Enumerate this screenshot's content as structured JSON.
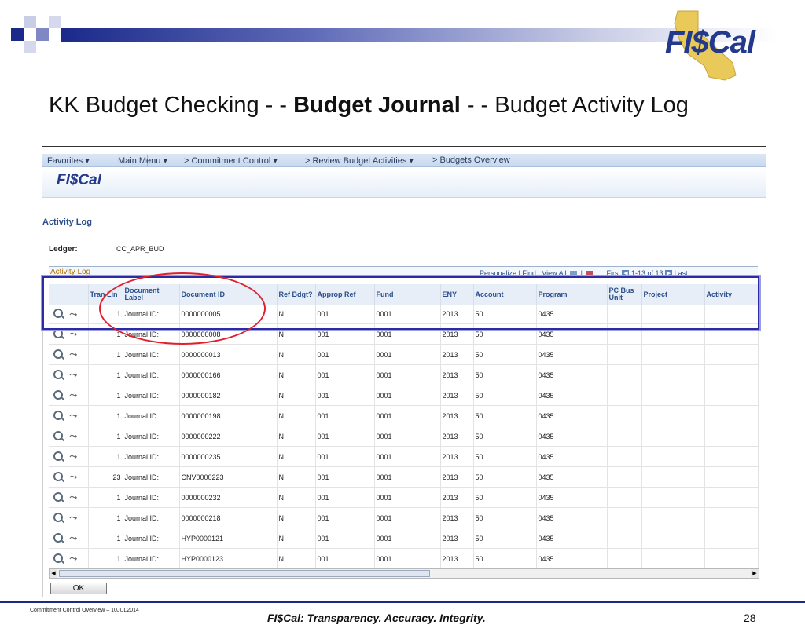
{
  "slide": {
    "logo_text": "FI$Cal",
    "title_prefix": "KK Budget Checking - - ",
    "title_bold": "Budget Journal",
    "title_suffix": " - - Budget Activity Log",
    "footer_left": "Commitment Control Overview – 10JUL2014",
    "footer_center": "FI$Cal:  Transparency.  Accuracy.  Integrity.",
    "page_number": "28"
  },
  "nav": {
    "favorites": "Favorites ▾",
    "main_menu": "Main Menu ▾",
    "crumb1": "> Commitment Control ▾",
    "crumb2": "> Review Budget Activities ▾",
    "crumb3": "> Budgets Overview"
  },
  "app": {
    "logo_text": "FI$Cal"
  },
  "page": {
    "heading": "Activity Log",
    "ledger_label": "Ledger:",
    "ledger_value": "CC_APR_BUD"
  },
  "grid": {
    "title": "Activity Log",
    "personalize": "Personalize",
    "find": "Find",
    "view_all": "View All",
    "first": "First",
    "range": "1-13 of 13",
    "last": "Last",
    "columns": [
      "",
      "",
      "Tran Lin",
      "Document Label",
      "Document ID",
      "Ref Bdgt?",
      "Approp Ref",
      "Fund",
      "ENY",
      "Account",
      "Program",
      "PC Bus Unit",
      "Project",
      "Activity"
    ],
    "rows": [
      {
        "line": "1",
        "label": "Journal ID:",
        "doc_id": "0000000005",
        "ref": "N",
        "approp": "001",
        "fund": "0001",
        "eny": "2013",
        "account": "50",
        "program": "0435"
      },
      {
        "line": "1",
        "label": "Journal ID:",
        "doc_id": "0000000008",
        "ref": "N",
        "approp": "001",
        "fund": "0001",
        "eny": "2013",
        "account": "50",
        "program": "0435"
      },
      {
        "line": "1",
        "label": "Journal ID:",
        "doc_id": "0000000013",
        "ref": "N",
        "approp": "001",
        "fund": "0001",
        "eny": "2013",
        "account": "50",
        "program": "0435"
      },
      {
        "line": "1",
        "label": "Journal ID:",
        "doc_id": "0000000166",
        "ref": "N",
        "approp": "001",
        "fund": "0001",
        "eny": "2013",
        "account": "50",
        "program": "0435"
      },
      {
        "line": "1",
        "label": "Journal ID:",
        "doc_id": "0000000182",
        "ref": "N",
        "approp": "001",
        "fund": "0001",
        "eny": "2013",
        "account": "50",
        "program": "0435"
      },
      {
        "line": "1",
        "label": "Journal ID:",
        "doc_id": "0000000198",
        "ref": "N",
        "approp": "001",
        "fund": "0001",
        "eny": "2013",
        "account": "50",
        "program": "0435"
      },
      {
        "line": "1",
        "label": "Journal ID:",
        "doc_id": "0000000222",
        "ref": "N",
        "approp": "001",
        "fund": "0001",
        "eny": "2013",
        "account": "50",
        "program": "0435"
      },
      {
        "line": "1",
        "label": "Journal ID:",
        "doc_id": "0000000235",
        "ref": "N",
        "approp": "001",
        "fund": "0001",
        "eny": "2013",
        "account": "50",
        "program": "0435"
      },
      {
        "line": "23",
        "label": "Journal ID:",
        "doc_id": "CNV0000223",
        "ref": "N",
        "approp": "001",
        "fund": "0001",
        "eny": "2013",
        "account": "50",
        "program": "0435"
      },
      {
        "line": "1",
        "label": "Journal ID:",
        "doc_id": "0000000232",
        "ref": "N",
        "approp": "001",
        "fund": "0001",
        "eny": "2013",
        "account": "50",
        "program": "0435"
      },
      {
        "line": "1",
        "label": "Journal ID:",
        "doc_id": "0000000218",
        "ref": "N",
        "approp": "001",
        "fund": "0001",
        "eny": "2013",
        "account": "50",
        "program": "0435"
      },
      {
        "line": "1",
        "label": "Journal ID:",
        "doc_id": "HYP0000121",
        "ref": "N",
        "approp": "001",
        "fund": "0001",
        "eny": "2013",
        "account": "50",
        "program": "0435"
      },
      {
        "line": "1",
        "label": "Journal ID:",
        "doc_id": "HYP0000123",
        "ref": "N",
        "approp": "001",
        "fund": "0001",
        "eny": "2013",
        "account": "50",
        "program": "0435"
      }
    ]
  },
  "ok_label": "OK",
  "colors": {
    "accent": "#1b2a8a",
    "highlight_rect": "#2b2ba8",
    "highlight_oval": "#e0202a",
    "grid_title": "#b07000"
  },
  "icons": {
    "view": "magnifier-icon",
    "drill": "drill-icon"
  }
}
